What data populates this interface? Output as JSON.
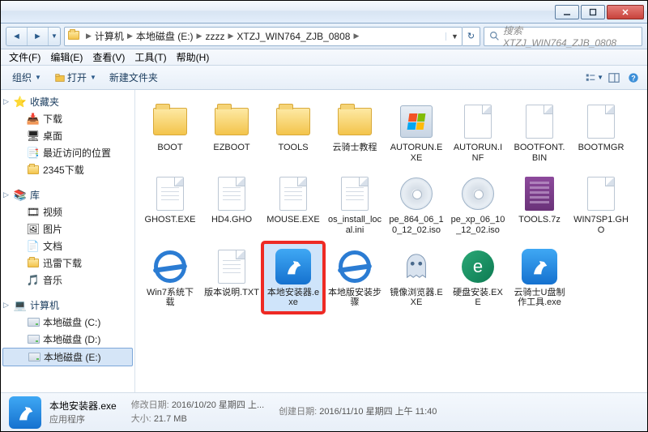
{
  "breadcrumbs": [
    "计算机",
    "本地磁盘 (E:)",
    "zzzz",
    "XTZJ_WIN764_ZJB_0808"
  ],
  "search": {
    "placeholder": "搜索 XTZJ_WIN764_ZJB_0808"
  },
  "menu": {
    "file": "文件(F)",
    "edit": "编辑(E)",
    "view": "查看(V)",
    "tools": "工具(T)",
    "help": "帮助(H)"
  },
  "toolbar": {
    "organize": "组织",
    "open": "打开",
    "newfolder": "新建文件夹"
  },
  "sidebar": {
    "favorites": {
      "label": "收藏夹",
      "items": [
        "下载",
        "桌面",
        "最近访问的位置",
        "2345下载"
      ]
    },
    "libraries": {
      "label": "库",
      "items": [
        "视频",
        "图片",
        "文档",
        "迅雷下载",
        "音乐"
      ]
    },
    "computer": {
      "label": "计算机",
      "items": [
        "本地磁盘 (C:)",
        "本地磁盘 (D:)",
        "本地磁盘 (E:)"
      ]
    }
  },
  "files": [
    {
      "name": "BOOT",
      "type": "folder"
    },
    {
      "name": "EZBOOT",
      "type": "folder"
    },
    {
      "name": "TOOLS",
      "type": "folder"
    },
    {
      "name": "云骑士教程",
      "type": "folder"
    },
    {
      "name": "AUTORUN.EXE",
      "type": "exe"
    },
    {
      "name": "AUTORUN.INF",
      "type": "file"
    },
    {
      "name": "BOOTFONT.BIN",
      "type": "file"
    },
    {
      "name": "BOOTMGR",
      "type": "file"
    },
    {
      "name": "GHOST.EXE",
      "type": "filelines"
    },
    {
      "name": "HD4.GHO",
      "type": "filelines"
    },
    {
      "name": "MOUSE.EXE",
      "type": "filelines"
    },
    {
      "name": "os_install_local.ini",
      "type": "filelines"
    },
    {
      "name": "pe_864_06_10_12_02.iso",
      "type": "disc"
    },
    {
      "name": "pe_xp_06_10_12_02.iso",
      "type": "disc"
    },
    {
      "name": "TOOLS.7z",
      "type": "rar"
    },
    {
      "name": "WIN7SP1.GHO",
      "type": "file"
    },
    {
      "name": "Win7系统下载",
      "type": "ie"
    },
    {
      "name": "版本说明.TXT",
      "type": "filelines"
    },
    {
      "name": "本地安装器.exe",
      "type": "knight",
      "selected": true,
      "highlight": true
    },
    {
      "name": "本地版安装步骤",
      "type": "ie"
    },
    {
      "name": "镜像浏览器.EXE",
      "type": "ghost"
    },
    {
      "name": "硬盘安装.EXE",
      "type": "swirl"
    },
    {
      "name": "云骑士U盘制作工具.exe",
      "type": "knight"
    }
  ],
  "details": {
    "name": "本地安装器.exe",
    "type": "应用程序",
    "modLabel": "修改日期:",
    "modValue": "2016/10/20 星期四 上...",
    "sizeLabel": "大小:",
    "sizeValue": "21.7 MB",
    "createLabel": "创建日期:",
    "createValue": "2016/11/10 星期四 上午 11:40"
  }
}
